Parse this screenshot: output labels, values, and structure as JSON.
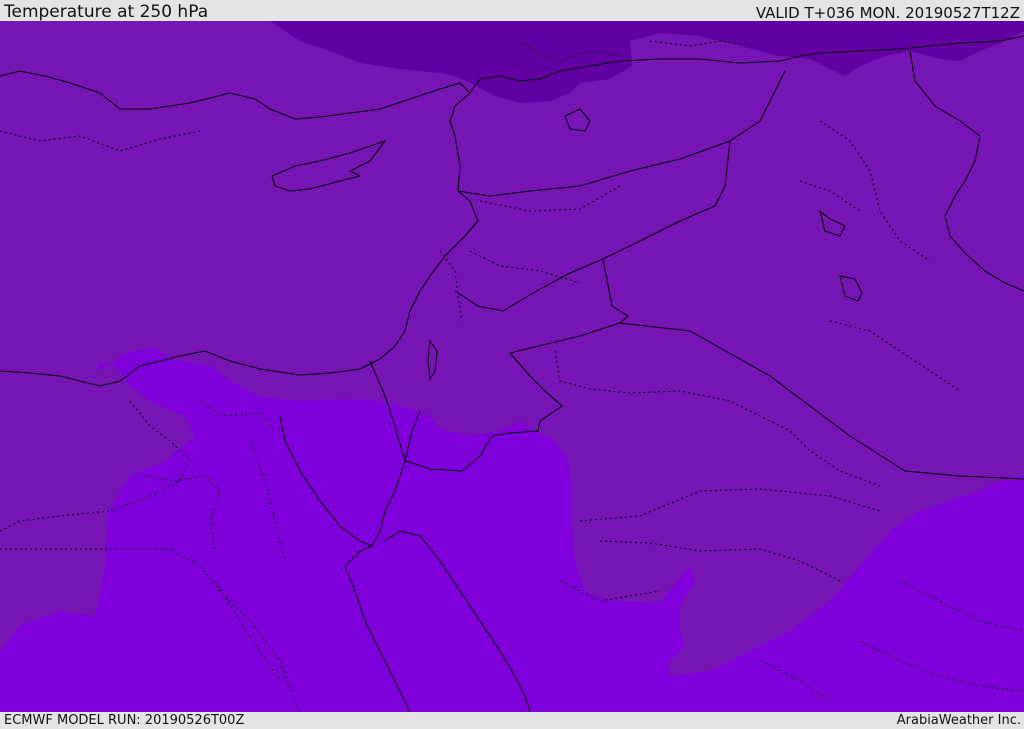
{
  "header": {
    "title": "Temperature at 250 hPa",
    "valid": "VALID T+036 MON. 20190527T12Z"
  },
  "footer": {
    "model_run": "ECMWF MODEL RUN: 20190526T00Z",
    "credit": "ArabiaWeather Inc."
  },
  "map": {
    "field_colors": {
      "cold_band": "#6200a4",
      "mid_band": "#7714b4",
      "warm_band": "#8000dc"
    },
    "border_color": "#000000"
  }
}
